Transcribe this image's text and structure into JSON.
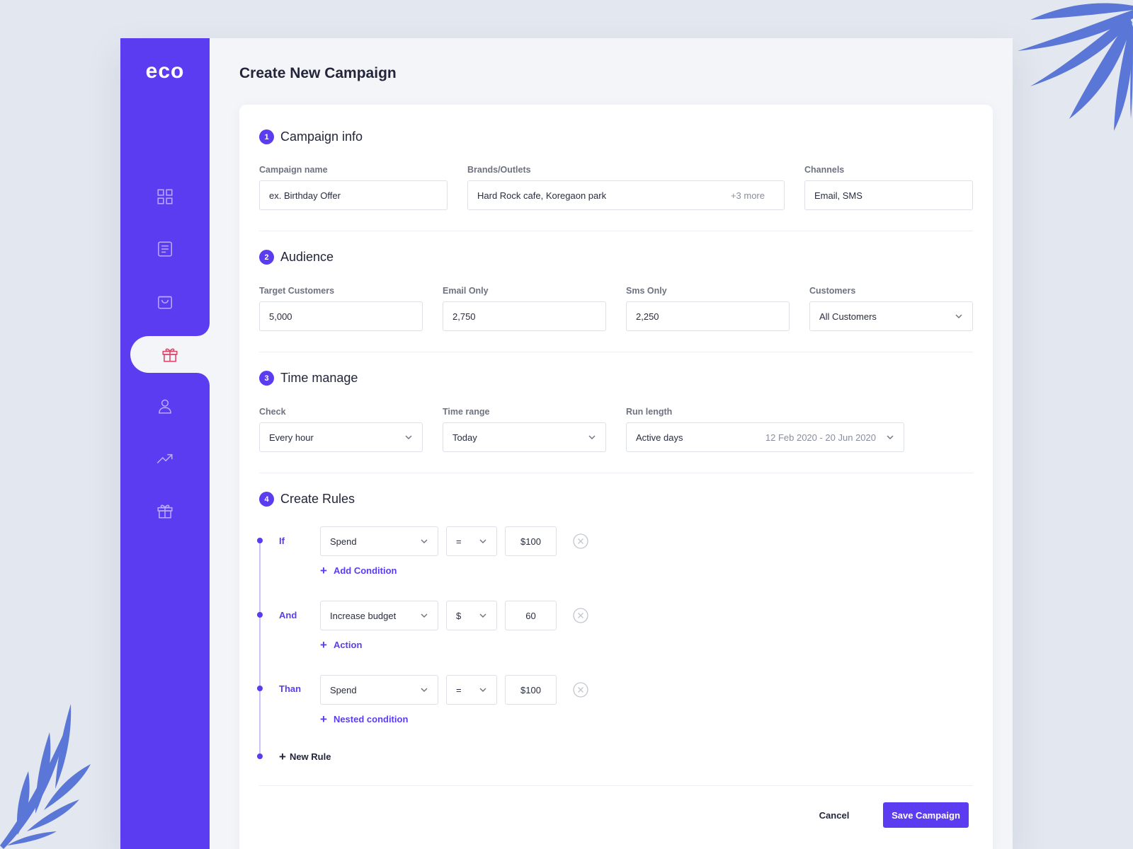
{
  "app": {
    "logo": "eco",
    "accent_color": "#5b3cf0",
    "active_icon_color": "#e0476d"
  },
  "sidebar": {
    "items": [
      {
        "icon": "grid-icon",
        "active": false
      },
      {
        "icon": "document-icon",
        "active": false
      },
      {
        "icon": "bag-icon",
        "active": false
      },
      {
        "icon": "gift-icon",
        "active": true
      },
      {
        "icon": "user-icon",
        "active": false
      },
      {
        "icon": "trending-up-icon",
        "active": false
      },
      {
        "icon": "gift-icon",
        "active": false
      }
    ]
  },
  "page": {
    "title": "Create New Campaign"
  },
  "campaign_info": {
    "step": "1",
    "title": "Campaign info",
    "campaign_name_label": "Campaign name",
    "campaign_name_placeholder": "ex. Birthday Offer",
    "brands_label": "Brands/Outlets",
    "brands_value": "Hard Rock cafe, Koregaon park",
    "brands_more": "+3 more",
    "channels_label": "Channels",
    "channels_value": "Email, SMS"
  },
  "audience": {
    "step": "2",
    "title": "Audience",
    "target_label": "Target Customers",
    "target_value": "5,000",
    "email_label": "Email Only",
    "email_value": "2,750",
    "sms_label": "Sms Only",
    "sms_value": "2,250",
    "customers_label": "Customers",
    "customers_value": "All Customers"
  },
  "time_manage": {
    "step": "3",
    "title": "Time manage",
    "check_label": "Check",
    "check_value": "Every hour",
    "range_label": "Time range",
    "range_value": "Today",
    "run_label": "Run length",
    "run_value": "Active days",
    "run_dates": "12 Feb 2020 - 20 Jun 2020"
  },
  "rules": {
    "step": "4",
    "title": "Create Rules",
    "rows": [
      {
        "label": "If",
        "field": "Spend",
        "operator": "=",
        "value": "$100",
        "link": "Add Condition"
      },
      {
        "label": "And",
        "field": "Increase budget",
        "operator": "$",
        "value": "60",
        "link": "Action"
      },
      {
        "label": "Than",
        "field": "Spend",
        "operator": "=",
        "value": "$100",
        "link": "Nested condition"
      }
    ],
    "new_rule": "New Rule"
  },
  "actions": {
    "cancel": "Cancel",
    "save": "Save Campaign"
  }
}
